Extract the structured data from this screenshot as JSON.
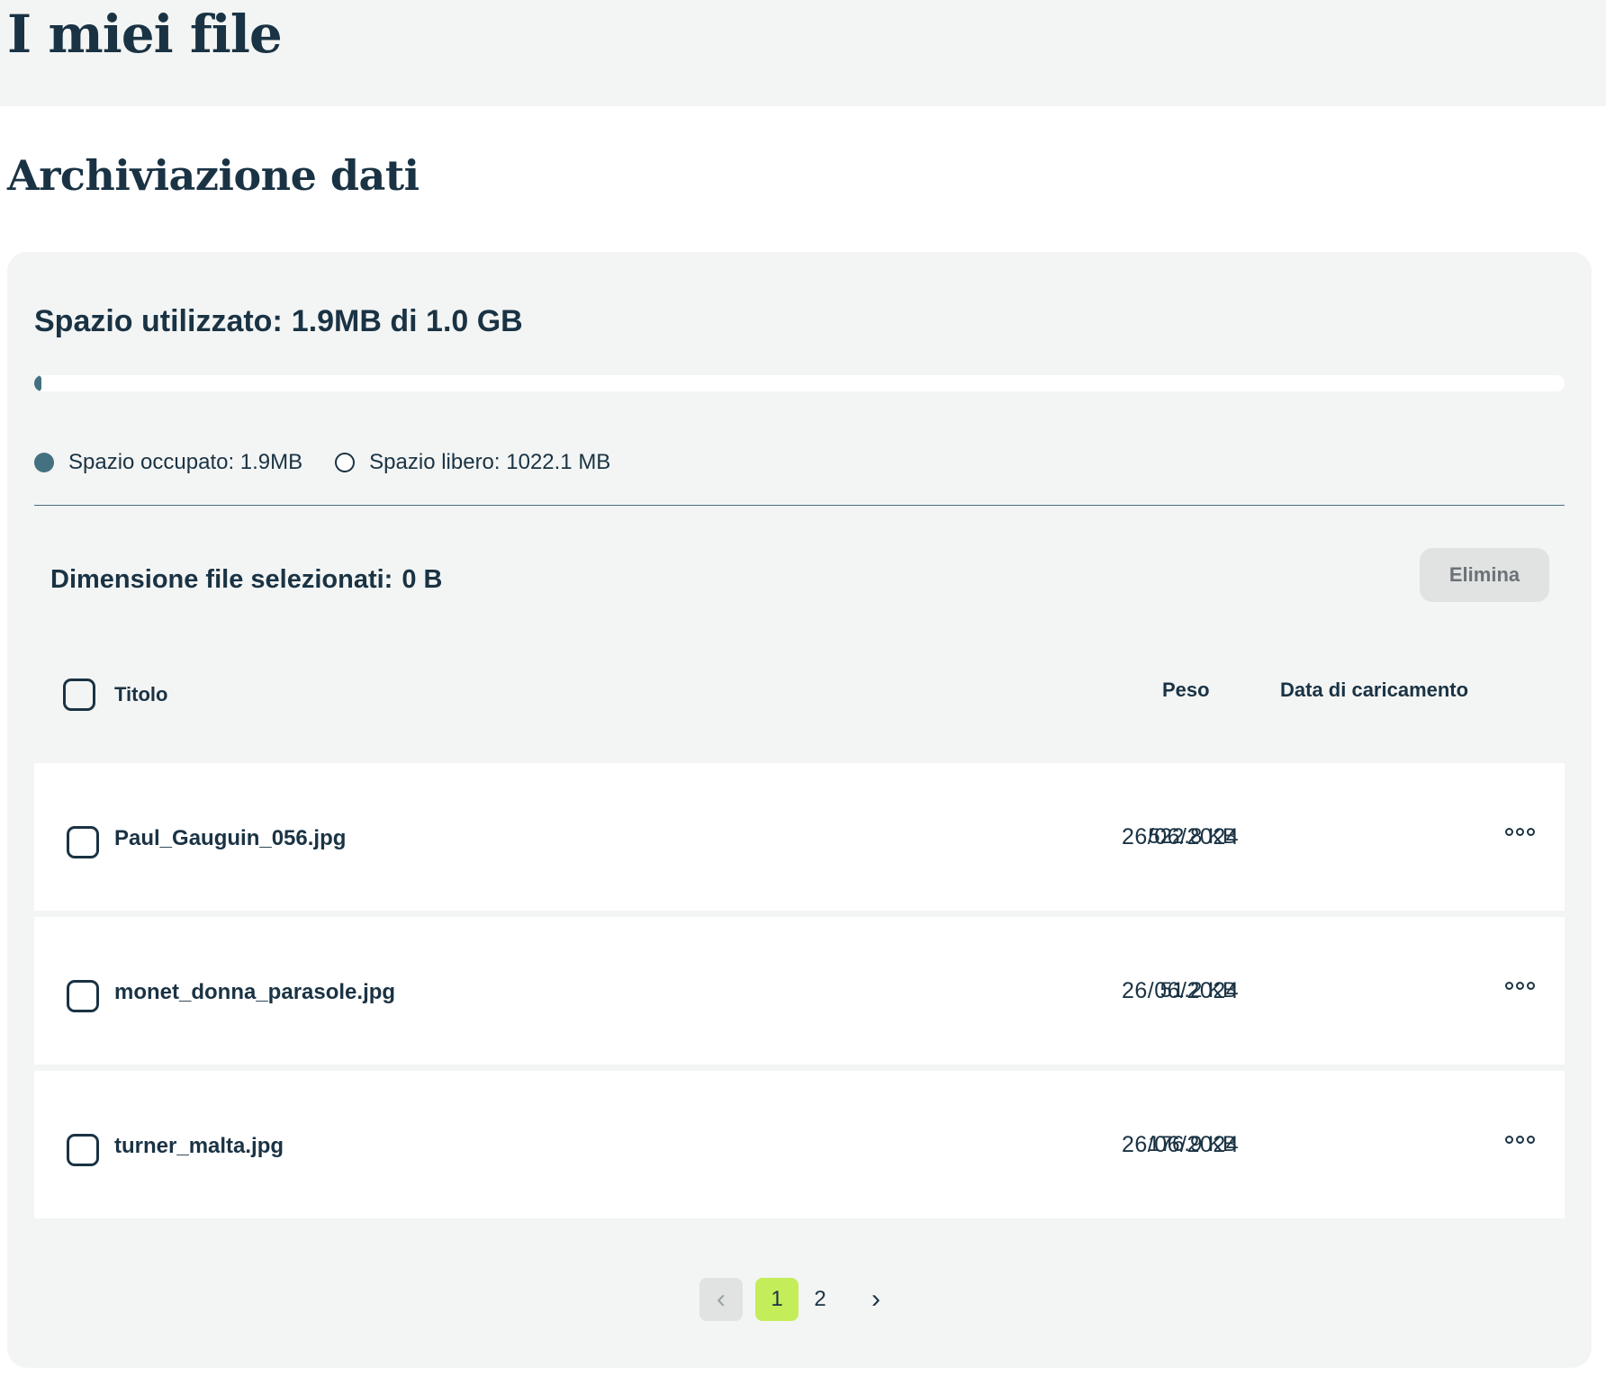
{
  "header": {
    "title": "I miei file"
  },
  "section": {
    "title": "Archiviazione dati"
  },
  "storage": {
    "used_label": "Spazio utilizzato:",
    "used_value": "1.9MB di 1.0 GB",
    "used_fraction": 0.0019,
    "legend_used": "Spazio occupato: 1.9MB",
    "legend_free": "Spazio libero: 1022.1 MB",
    "accent_color": "#43717f"
  },
  "selection": {
    "label": "Dimensione file selezionati:",
    "value": "0 B",
    "delete_label": "Elimina"
  },
  "table": {
    "headers": {
      "title": "Titolo",
      "size": "Peso",
      "date": "Data di caricamento"
    },
    "rows": [
      {
        "name": "Paul_Gauguin_056.jpg",
        "size": "522.8 KB",
        "date": "26/06/2024"
      },
      {
        "name": "monet_donna_parasole.jpg",
        "size": "51.2 KB",
        "date": "26/06/2024"
      },
      {
        "name": "turner_malta.jpg",
        "size": "176.9 KB",
        "date": "26/06/2024"
      }
    ]
  },
  "pagination": {
    "pages": [
      "1",
      "2"
    ],
    "current": "1",
    "active_color": "#c4ed5a"
  }
}
